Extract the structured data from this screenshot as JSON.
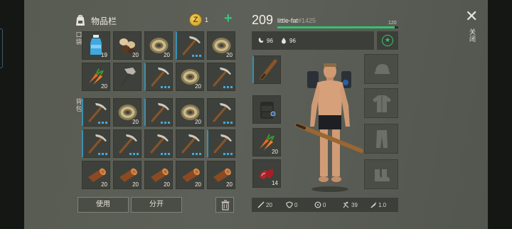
{
  "inventory": {
    "title": "物品栏",
    "pocket_label": "口袋",
    "backpack_label": "背包",
    "coins": "1",
    "add_label": "+",
    "use_label": "使用",
    "split_label": "分开",
    "slots": [
      {
        "item": "water-bottle",
        "qty": "19"
      },
      {
        "item": "seeds",
        "qty": "20"
      },
      {
        "item": "rope-coil",
        "qty": "20"
      },
      {
        "item": "pickaxe",
        "qty": ""
      },
      {
        "item": "rope-coil",
        "qty": "20"
      },
      {
        "item": "carrot",
        "qty": "20"
      },
      {
        "item": "hammer",
        "qty": ""
      },
      {
        "item": "pickaxe",
        "qty": ""
      },
      {
        "item": "rope-coil",
        "qty": "20"
      },
      {
        "item": "pickaxe",
        "qty": ""
      },
      {
        "item": "pickaxe",
        "qty": ""
      },
      {
        "item": "rope-coil",
        "qty": "20"
      },
      {
        "item": "pickaxe",
        "qty": ""
      },
      {
        "item": "rope-coil",
        "qty": "20"
      },
      {
        "item": "pickaxe",
        "qty": ""
      },
      {
        "item": "pickaxe",
        "qty": ""
      },
      {
        "item": "pickaxe",
        "qty": ""
      },
      {
        "item": "pickaxe",
        "qty": ""
      },
      {
        "item": "pickaxe",
        "qty": ""
      },
      {
        "item": "pickaxe",
        "qty": ""
      },
      {
        "item": "log",
        "qty": "20"
      },
      {
        "item": "log",
        "qty": "20"
      },
      {
        "item": "log",
        "qty": "20"
      },
      {
        "item": "log",
        "qty": "20"
      },
      {
        "item": "log",
        "qty": "20"
      }
    ]
  },
  "player": {
    "level": "209",
    "name": "little-fat",
    "id": "#1425",
    "xp_max": "120",
    "xp_fraction": 0.97,
    "food": "96",
    "water": "96"
  },
  "equipment": {
    "weapon_qty": "",
    "backpack_qty": "",
    "food_qty": "20",
    "meat_qty": "14"
  },
  "combat_stats": {
    "attack": "20",
    "defense": "0",
    "protection": "0",
    "speed": "39",
    "damage_mult": "1.0"
  },
  "close_label": "关闭",
  "colors": {
    "accent_green": "#33c26f",
    "slot_blue": "#3a8fb0",
    "bottle_blue": "#3fa9e0"
  }
}
